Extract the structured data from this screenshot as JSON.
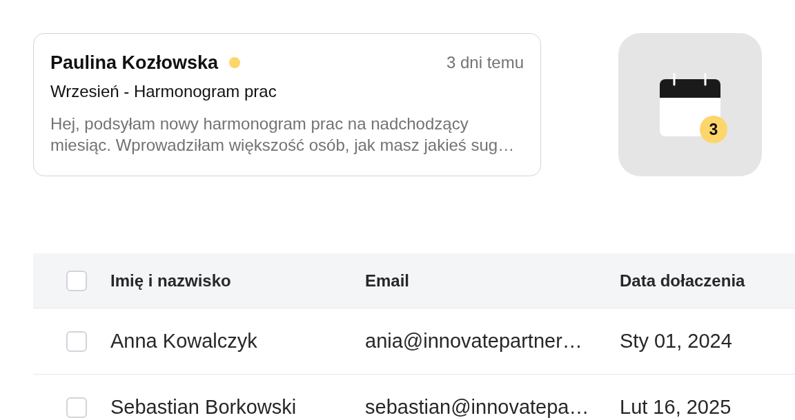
{
  "message_card": {
    "sender": "Paulina Kozłowska",
    "unread": true,
    "time": "3 dni temu",
    "subject": "Wrzesień - Harmonogram prac",
    "preview": "Hej, podsyłam nowy harmonogram prac na nadchodzący miesiąc. Wprowadziłam większość osób, jak masz jakieś sug…"
  },
  "calendar_tile": {
    "badge": "3"
  },
  "table": {
    "select_all": {
      "checked": false
    },
    "columns": [
      "Imię i nazwisko",
      "Email",
      "Data dołaczenia"
    ],
    "rows": [
      {
        "checked": false,
        "cells": [
          "Anna Kowalczyk",
          "ania@innovatepartner…",
          "Sty 01, 2024"
        ]
      },
      {
        "checked": false,
        "cells": [
          "Sebastian Borkowski",
          "sebastian@innovatepa…",
          "Lut 16, 2025"
        ]
      }
    ]
  }
}
